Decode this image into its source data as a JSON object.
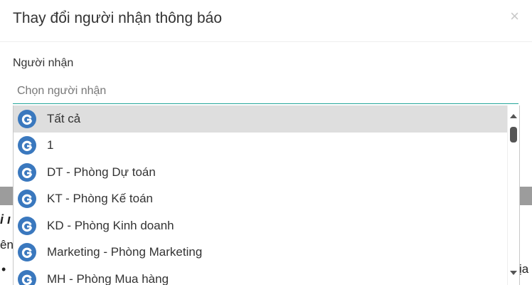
{
  "dialog": {
    "title": "Thay đổi người nhận thông báo",
    "close_label": "×"
  },
  "field": {
    "label": "Người nhận",
    "placeholder": "Chọn người nhận"
  },
  "dropdown": {
    "options": [
      {
        "label": "Tất cả",
        "icon": "group-g-icon",
        "active": true
      },
      {
        "label": "1",
        "icon": "group-g-icon",
        "active": false
      },
      {
        "label": "DT - Phòng Dự toán",
        "icon": "group-g-icon",
        "active": false
      },
      {
        "label": "KT - Phòng Kế toán",
        "icon": "group-g-icon",
        "active": false
      },
      {
        "label": "KD - Phòng Kinh doanh",
        "icon": "group-g-icon",
        "active": false
      },
      {
        "label": "Marketing - Phòng Marketing",
        "icon": "group-g-icon",
        "active": false
      },
      {
        "label": "MH - Phòng Mua hàng",
        "icon": "group-g-icon",
        "active": false
      }
    ]
  },
  "background": {
    "fragment_1": "i ı",
    "fragment_2": "ên",
    "fragment_3": "•",
    "fragment_4": "ịa"
  },
  "colors": {
    "icon_blue": "#3a78be",
    "input_underline": "#26a69a",
    "active_row": "#dedede"
  }
}
